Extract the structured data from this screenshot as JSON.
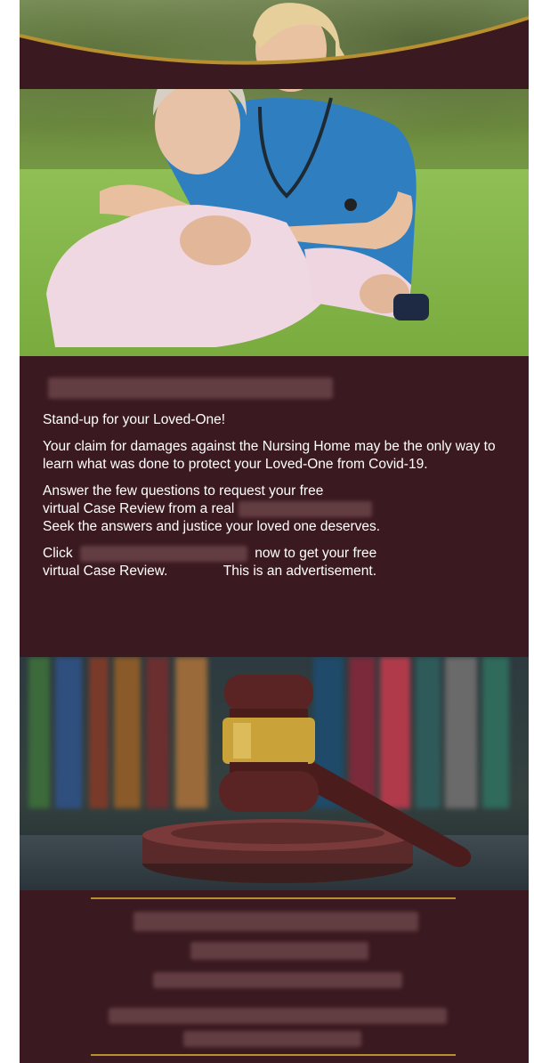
{
  "ad": {
    "headline_redacted": "",
    "paragraphs": {
      "p1": "Stand-up for your Loved-One!",
      "p2": "Your claim for damages against the Nursing Home may be the only way to learn what was done to protect your Loved-One from Covid-19.",
      "p3_line1": "Answer the few questions to request your free",
      "p3_line2": "virtual Case Review from a real",
      "p3_line3": "Seek the answers and justice your loved one deserves.",
      "p4_click": "Click",
      "p4_now": "now to get your free",
      "p4_line2": "virtual Case Review.",
      "p4_advert": "This is an advertisement."
    }
  },
  "colors": {
    "background": "#3a1a20",
    "accent_gold": "#b8902f",
    "text": "#ffffff"
  },
  "images": {
    "hero": "nurse-and-elderly-woman-photo",
    "gavel": "gavel-and-books-photo"
  }
}
